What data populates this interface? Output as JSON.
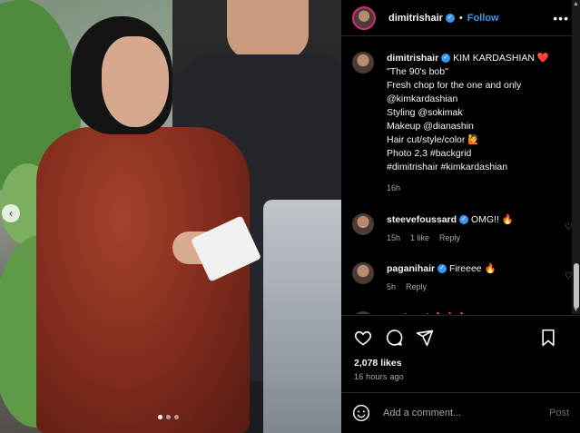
{
  "post": {
    "username": "dimitrishair",
    "follow_label": "Follow",
    "separator": "•",
    "more_icon": "ellipsis-icon"
  },
  "caption": {
    "username": "dimitrishair",
    "lines": [
      "KIM KARDASHIAN ❤️",
      "\"The 90's bob\"",
      "Fresh chop for the one and only",
      "@kimkardashian",
      "Styling @sokimak",
      "Makeup @dianashin",
      "Hair cut/style/color 🙋",
      "Photo 2,3 #backgrid",
      "#dimitrishair #kimkardashian"
    ],
    "age": "16h"
  },
  "comments": [
    {
      "username": "steevefoussard",
      "text": "OMG!! 🔥",
      "age": "15h",
      "likes": "1 like",
      "reply": "Reply"
    },
    {
      "username": "paganihair",
      "text": "Fireeee 🔥",
      "age": "5h",
      "reply": "Reply"
    },
    {
      "username": "nattiventi",
      "text": "🔥🔥🔥"
    }
  ],
  "actions": {
    "likes": "2,078 likes",
    "timestamp": "16 hours ago"
  },
  "composer": {
    "placeholder": "Add a comment...",
    "post_label": "Post"
  },
  "carousel": {
    "dots": 3,
    "active_index": 0
  },
  "colors": {
    "accent": "#3897f0",
    "background": "#000000",
    "muted": "#a8a8a8"
  }
}
